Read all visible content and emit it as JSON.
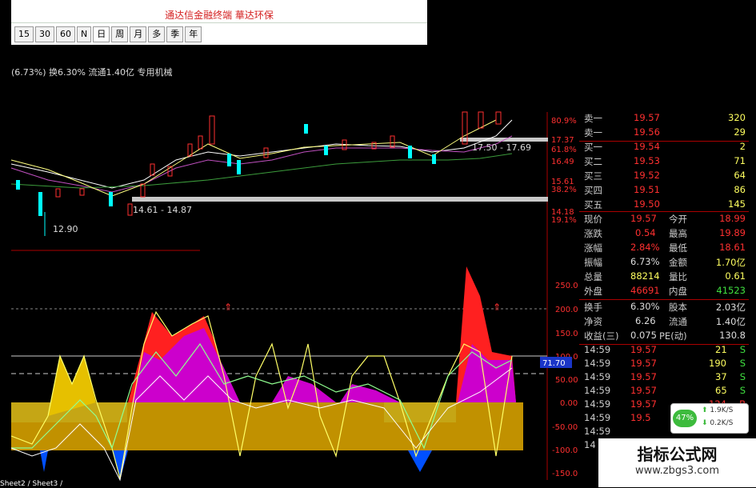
{
  "app": {
    "title": "通达信金融终端   華达环保"
  },
  "toolbar": {
    "periods": [
      "15",
      "30",
      "60",
      "N",
      "日",
      "周",
      "月",
      "多",
      "季",
      "年"
    ],
    "active": "日"
  },
  "stock_info": "(6.73%) 换6.30% 流通1.40亿 专用机械",
  "main_chart": {
    "price_labels": [
      "12.90",
      "14.61 - 14.87",
      "17.50 - 17.69"
    ],
    "axis_labels": [
      {
        "price": "17.37",
        "pct": "61.8%"
      },
      {
        "price": "16.49",
        "pct": ""
      },
      {
        "price": "15.61",
        "pct": "38.2%"
      },
      {
        "price": "14.18",
        "pct": "19.1%"
      },
      {
        "price": "",
        "pct": "80.9%"
      }
    ]
  },
  "indicator": {
    "ticks": [
      "250.0",
      "200.0",
      "150.0",
      "100.0",
      "50.00",
      "0.00",
      "-50.00",
      "-100.0",
      "-150.0"
    ],
    "current_value": "71.70"
  },
  "order_book": [
    {
      "label": "卖一",
      "price": "19.57",
      "vol": "320"
    },
    {
      "label": "卖一",
      "price": "19.56",
      "vol": "29"
    },
    {
      "label": "买一",
      "price": "19.54",
      "vol": "2"
    },
    {
      "label": "买二",
      "price": "19.53",
      "vol": "71"
    },
    {
      "label": "买三",
      "price": "19.52",
      "vol": "64"
    },
    {
      "label": "买四",
      "price": "19.51",
      "vol": "86"
    },
    {
      "label": "买五",
      "price": "19.50",
      "vol": "145"
    }
  ],
  "quote": [
    {
      "l1": "现价",
      "v1": "19.57",
      "l2": "今开",
      "v2": "18.99"
    },
    {
      "l1": "涨跌",
      "v1": "0.54",
      "l2": "最高",
      "v2": "19.89"
    },
    {
      "l1": "涨幅",
      "v1": "2.84%",
      "l2": "最低",
      "v2": "18.61"
    },
    {
      "l1": "振幅",
      "v1": "6.73%",
      "l2": "金额",
      "v2": "1.70亿"
    },
    {
      "l1": "总量",
      "v1": "88214",
      "l2": "量比",
      "v2": "0.61"
    },
    {
      "l1": "外盘",
      "v1": "46691",
      "l2": "内盘",
      "v2": "41523"
    },
    {
      "l1": "换手",
      "v1": "6.30%",
      "l2": "股本",
      "v2": "2.03亿"
    },
    {
      "l1": "净资",
      "v1": "6.26",
      "l2": "流通",
      "v2": "1.40亿"
    },
    {
      "l1": "收益(三)",
      "v1": "0.075",
      "l2": "PE(动)",
      "v2": "130.8"
    }
  ],
  "trades": [
    {
      "time": "14:59",
      "price": "19.57",
      "vol": "21",
      "side": "S"
    },
    {
      "time": "14:59",
      "price": "19.57",
      "vol": "190",
      "side": "S"
    },
    {
      "time": "14:59",
      "price": "19.57",
      "vol": "37",
      "side": "S"
    },
    {
      "time": "14:59",
      "price": "19.57",
      "vol": "65",
      "side": "S"
    },
    {
      "time": "14:59",
      "price": "19.57",
      "vol": "124",
      "side": "B"
    },
    {
      "time": "14:59",
      "price": "19.5",
      "vol": "",
      "side": ""
    },
    {
      "time": "14:59",
      "price": "",
      "vol": "",
      "side": ""
    },
    {
      "time": "14",
      "price": "",
      "vol": "",
      "side": ""
    }
  ],
  "net_widget": {
    "pct": "47%",
    "up": "1.9K/S",
    "down": "0.2K/S"
  },
  "watermark": {
    "cn": "指标公式网",
    "url": "www.zbgs3.com"
  },
  "sheet_tabs": "Sheet2 / Sheet3 /"
}
